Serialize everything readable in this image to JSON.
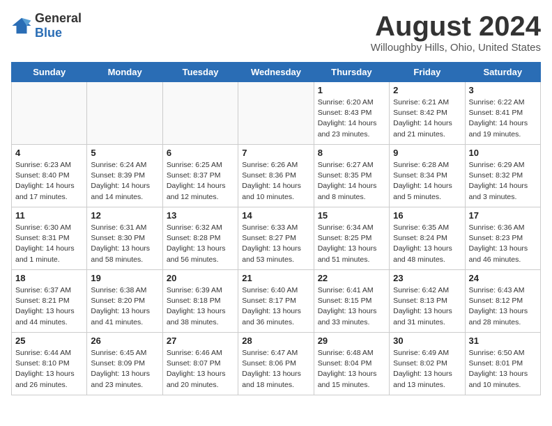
{
  "header": {
    "logo_general": "General",
    "logo_blue": "Blue",
    "month_year": "August 2024",
    "location": "Willoughby Hills, Ohio, United States"
  },
  "days_of_week": [
    "Sunday",
    "Monday",
    "Tuesday",
    "Wednesday",
    "Thursday",
    "Friday",
    "Saturday"
  ],
  "weeks": [
    [
      {
        "day": "",
        "info": ""
      },
      {
        "day": "",
        "info": ""
      },
      {
        "day": "",
        "info": ""
      },
      {
        "day": "",
        "info": ""
      },
      {
        "day": "1",
        "info": "Sunrise: 6:20 AM\nSunset: 8:43 PM\nDaylight: 14 hours\nand 23 minutes."
      },
      {
        "day": "2",
        "info": "Sunrise: 6:21 AM\nSunset: 8:42 PM\nDaylight: 14 hours\nand 21 minutes."
      },
      {
        "day": "3",
        "info": "Sunrise: 6:22 AM\nSunset: 8:41 PM\nDaylight: 14 hours\nand 19 minutes."
      }
    ],
    [
      {
        "day": "4",
        "info": "Sunrise: 6:23 AM\nSunset: 8:40 PM\nDaylight: 14 hours\nand 17 minutes."
      },
      {
        "day": "5",
        "info": "Sunrise: 6:24 AM\nSunset: 8:39 PM\nDaylight: 14 hours\nand 14 minutes."
      },
      {
        "day": "6",
        "info": "Sunrise: 6:25 AM\nSunset: 8:37 PM\nDaylight: 14 hours\nand 12 minutes."
      },
      {
        "day": "7",
        "info": "Sunrise: 6:26 AM\nSunset: 8:36 PM\nDaylight: 14 hours\nand 10 minutes."
      },
      {
        "day": "8",
        "info": "Sunrise: 6:27 AM\nSunset: 8:35 PM\nDaylight: 14 hours\nand 8 minutes."
      },
      {
        "day": "9",
        "info": "Sunrise: 6:28 AM\nSunset: 8:34 PM\nDaylight: 14 hours\nand 5 minutes."
      },
      {
        "day": "10",
        "info": "Sunrise: 6:29 AM\nSunset: 8:32 PM\nDaylight: 14 hours\nand 3 minutes."
      }
    ],
    [
      {
        "day": "11",
        "info": "Sunrise: 6:30 AM\nSunset: 8:31 PM\nDaylight: 14 hours\nand 1 minute."
      },
      {
        "day": "12",
        "info": "Sunrise: 6:31 AM\nSunset: 8:30 PM\nDaylight: 13 hours\nand 58 minutes."
      },
      {
        "day": "13",
        "info": "Sunrise: 6:32 AM\nSunset: 8:28 PM\nDaylight: 13 hours\nand 56 minutes."
      },
      {
        "day": "14",
        "info": "Sunrise: 6:33 AM\nSunset: 8:27 PM\nDaylight: 13 hours\nand 53 minutes."
      },
      {
        "day": "15",
        "info": "Sunrise: 6:34 AM\nSunset: 8:25 PM\nDaylight: 13 hours\nand 51 minutes."
      },
      {
        "day": "16",
        "info": "Sunrise: 6:35 AM\nSunset: 8:24 PM\nDaylight: 13 hours\nand 48 minutes."
      },
      {
        "day": "17",
        "info": "Sunrise: 6:36 AM\nSunset: 8:23 PM\nDaylight: 13 hours\nand 46 minutes."
      }
    ],
    [
      {
        "day": "18",
        "info": "Sunrise: 6:37 AM\nSunset: 8:21 PM\nDaylight: 13 hours\nand 44 minutes."
      },
      {
        "day": "19",
        "info": "Sunrise: 6:38 AM\nSunset: 8:20 PM\nDaylight: 13 hours\nand 41 minutes."
      },
      {
        "day": "20",
        "info": "Sunrise: 6:39 AM\nSunset: 8:18 PM\nDaylight: 13 hours\nand 38 minutes."
      },
      {
        "day": "21",
        "info": "Sunrise: 6:40 AM\nSunset: 8:17 PM\nDaylight: 13 hours\nand 36 minutes."
      },
      {
        "day": "22",
        "info": "Sunrise: 6:41 AM\nSunset: 8:15 PM\nDaylight: 13 hours\nand 33 minutes."
      },
      {
        "day": "23",
        "info": "Sunrise: 6:42 AM\nSunset: 8:13 PM\nDaylight: 13 hours\nand 31 minutes."
      },
      {
        "day": "24",
        "info": "Sunrise: 6:43 AM\nSunset: 8:12 PM\nDaylight: 13 hours\nand 28 minutes."
      }
    ],
    [
      {
        "day": "25",
        "info": "Sunrise: 6:44 AM\nSunset: 8:10 PM\nDaylight: 13 hours\nand 26 minutes."
      },
      {
        "day": "26",
        "info": "Sunrise: 6:45 AM\nSunset: 8:09 PM\nDaylight: 13 hours\nand 23 minutes."
      },
      {
        "day": "27",
        "info": "Sunrise: 6:46 AM\nSunset: 8:07 PM\nDaylight: 13 hours\nand 20 minutes."
      },
      {
        "day": "28",
        "info": "Sunrise: 6:47 AM\nSunset: 8:06 PM\nDaylight: 13 hours\nand 18 minutes."
      },
      {
        "day": "29",
        "info": "Sunrise: 6:48 AM\nSunset: 8:04 PM\nDaylight: 13 hours\nand 15 minutes."
      },
      {
        "day": "30",
        "info": "Sunrise: 6:49 AM\nSunset: 8:02 PM\nDaylight: 13 hours\nand 13 minutes."
      },
      {
        "day": "31",
        "info": "Sunrise: 6:50 AM\nSunset: 8:01 PM\nDaylight: 13 hours\nand 10 minutes."
      }
    ]
  ]
}
